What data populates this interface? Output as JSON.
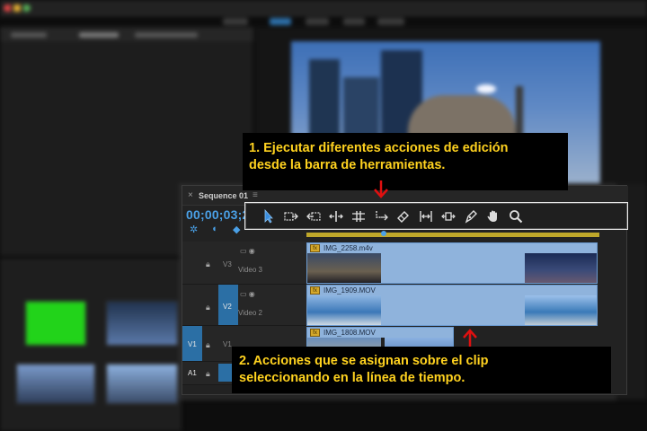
{
  "annotations": {
    "top_line1": "1. Ejecutar diferentes acciones de edición",
    "top_line2": "desde la barra de herramientas.",
    "bottom_line1": "2. Acciones que se asignan sobre el clip",
    "bottom_line2": "seleccionando en la línea de tiempo."
  },
  "timeline": {
    "close": "×",
    "sequence_name": "Sequence 01",
    "menu": "≡",
    "timecode": "00;00;03;2"
  },
  "tools": [
    {
      "name": "selection-tool-icon"
    },
    {
      "name": "track-select-forward-icon"
    },
    {
      "name": "ripple-edit-icon"
    },
    {
      "name": "rolling-edit-icon"
    },
    {
      "name": "rate-stretch-icon"
    },
    {
      "name": "razor-icon"
    },
    {
      "name": "slip-icon"
    },
    {
      "name": "slide-icon"
    },
    {
      "name": "pen-icon"
    },
    {
      "name": "hand-icon"
    },
    {
      "name": "zoom-icon"
    }
  ],
  "tracks": [
    {
      "id": "V3",
      "label": "Video 3",
      "clip": "IMG_2258.m4v"
    },
    {
      "id": "V2",
      "label": "Video 2",
      "clip": "IMG_1909.MOV"
    },
    {
      "id": "V1",
      "clip": "IMG_1808.MOV"
    },
    {
      "id": "A1"
    }
  ],
  "source_patch": {
    "v1": "V1",
    "a1": "A1"
  },
  "colors": {
    "annotation_text": "#ffd21f",
    "arrow": "#e01010",
    "accent": "#4aa0e6"
  }
}
